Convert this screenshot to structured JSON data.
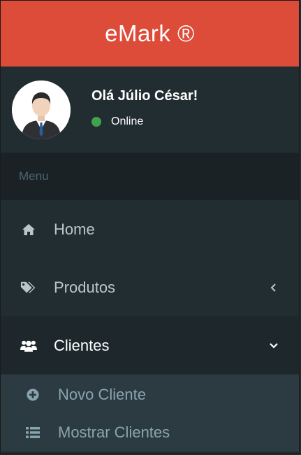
{
  "brand": {
    "title": "eMark ®"
  },
  "user": {
    "greeting": "Olá Júlio César!",
    "status": "Online",
    "status_color": "#3fa34d",
    "avatar_icon": "user-avatar-icon"
  },
  "menu": {
    "header": "Menu",
    "items": [
      {
        "label": "Home",
        "icon": "home-icon"
      },
      {
        "label": "Produtos",
        "icon": "tags-icon",
        "chevron": "chevron-left-icon"
      },
      {
        "label": "Clientes",
        "icon": "users-icon",
        "chevron": "chevron-down-icon",
        "active": true,
        "children": [
          {
            "label": "Novo Cliente",
            "icon": "plus-circle-icon"
          },
          {
            "label": "Mostrar Clientes",
            "icon": "list-icon"
          }
        ]
      }
    ]
  },
  "colors": {
    "brand": "#dd4b39",
    "sidebar": "#222d32",
    "active": "#1e282c",
    "submenu": "#2c3b41"
  }
}
